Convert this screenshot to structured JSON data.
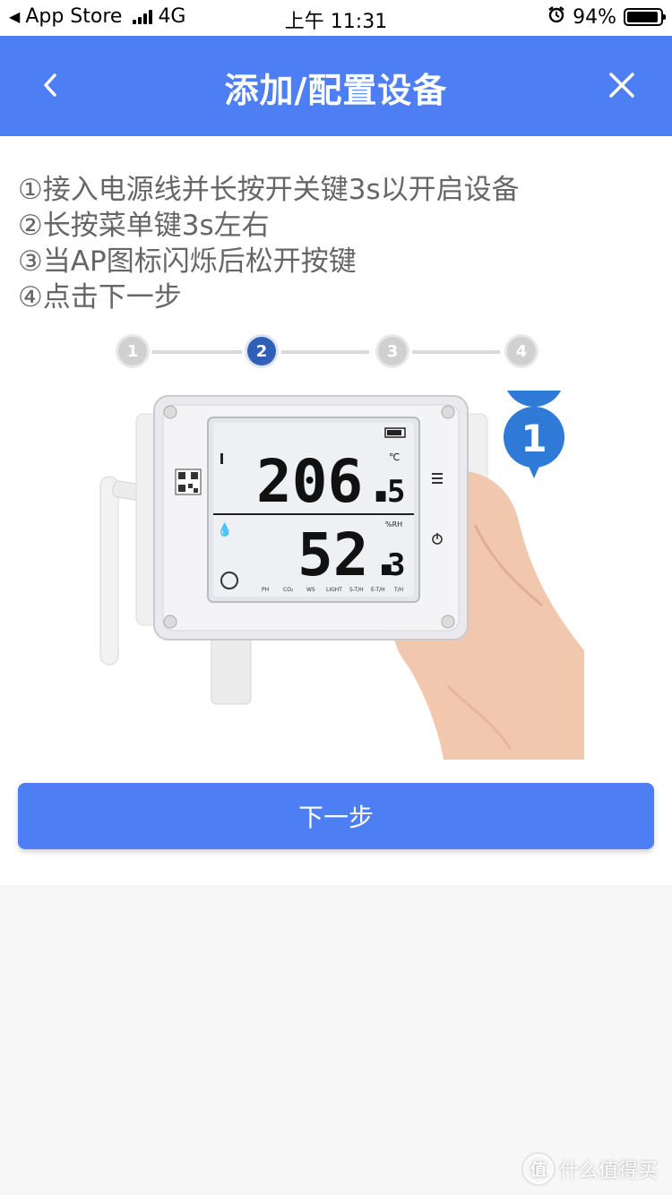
{
  "status_bar": {
    "back_app": "App Store",
    "network": "4G",
    "time": "上午 11:31",
    "battery": "94%",
    "battery_level": 0.94
  },
  "header": {
    "title": "添加/配置设备",
    "back_icon": "chevron-left-icon",
    "close_icon": "close-icon"
  },
  "instructions": [
    "①接入电源线并长按开关键3s以开启设备",
    "②长按菜单键3s左右",
    "③当AP图标闪烁后松开按键",
    "④点击下一步"
  ],
  "steps": {
    "labels": [
      "1",
      "2",
      "3",
      "4"
    ],
    "active_index": 1
  },
  "illustration": {
    "temp_value": "206.",
    "temp_decimal": "5",
    "temp_unit": "℃",
    "hum_value": "52.",
    "hum_decimal": "3",
    "hum_unit": "%RH",
    "bottom_labels": [
      "PH",
      "CO₂",
      "WS",
      "LIGHT",
      "S-T/H",
      "E-T/H",
      "T/H"
    ],
    "badge_number": "1"
  },
  "next_button": "下一步",
  "watermark": {
    "logo": "值",
    "text": "什么值得买"
  },
  "colors": {
    "primary": "#4e7ef3",
    "step_active": "#2f5fb6",
    "text_gray": "#666666"
  }
}
